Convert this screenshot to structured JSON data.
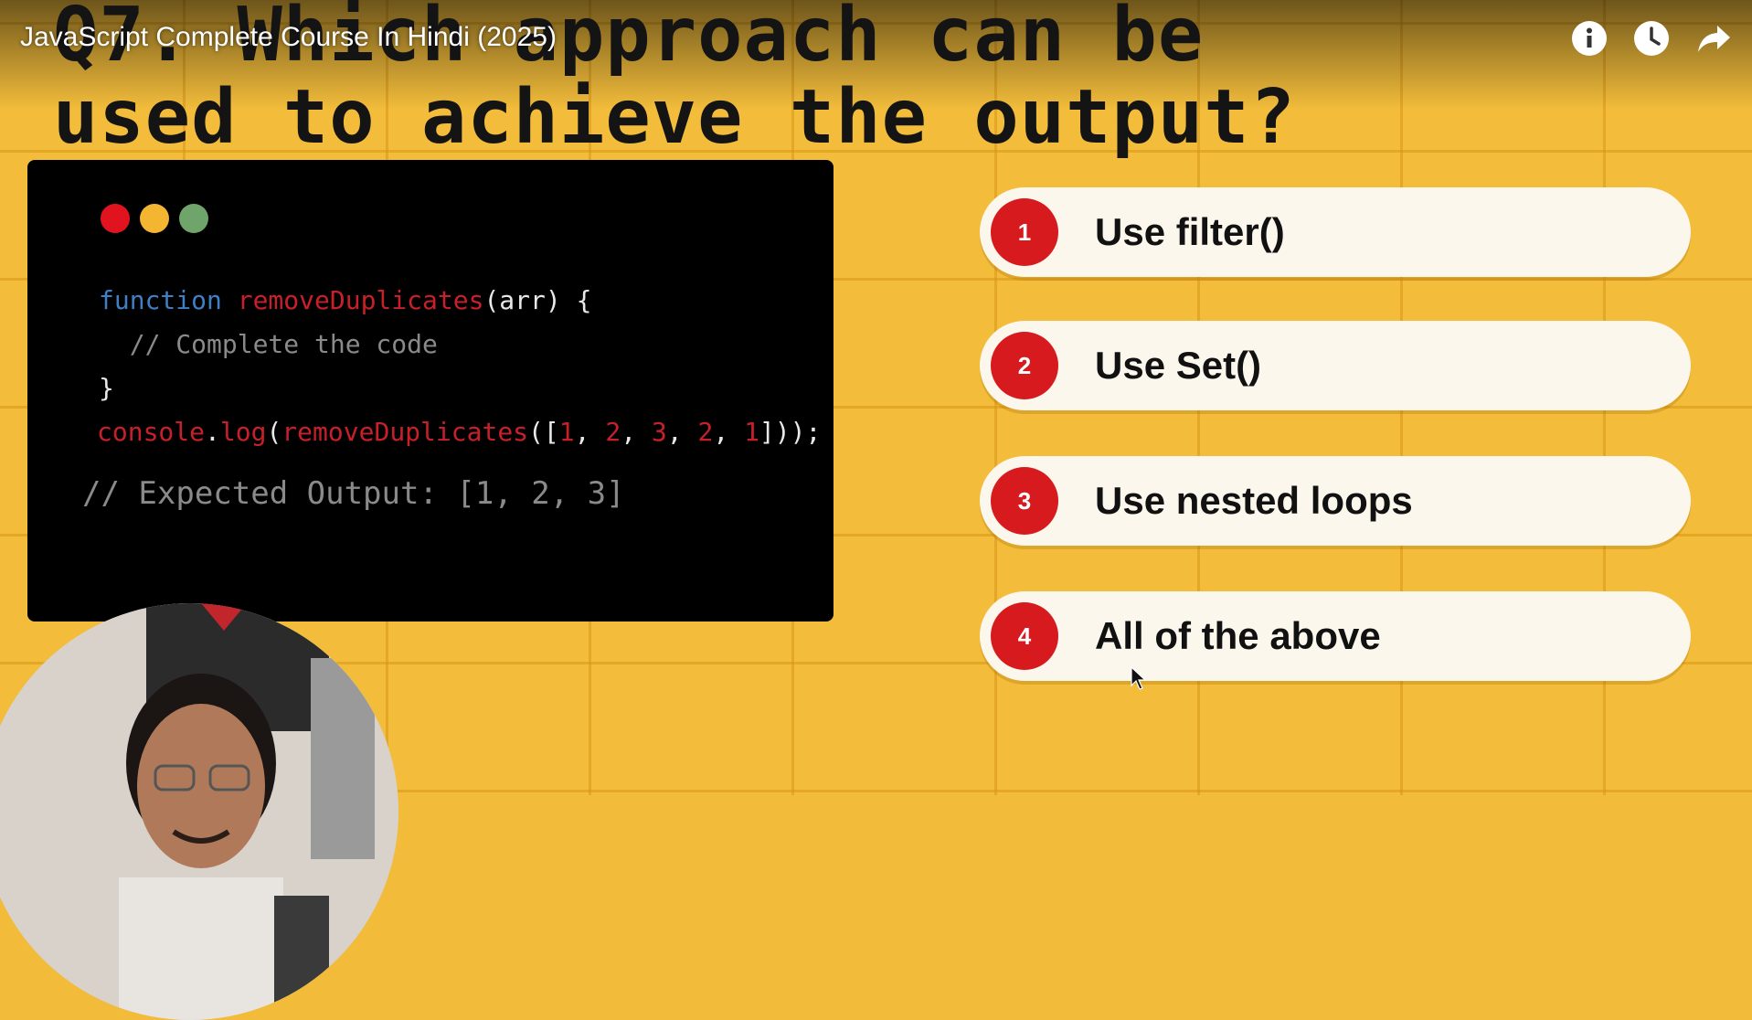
{
  "video": {
    "title": "JavaScript Complete Course In Hindi (2025)"
  },
  "top_icons": [
    "info-icon",
    "watch-later-icon",
    "share-icon"
  ],
  "slide": {
    "question_line1": "Q7. Which approach can be",
    "question_line2": "used to achieve the output?",
    "code": {
      "line1_kw": "function",
      "line1_fn": "removeDuplicates",
      "line1_rest": "(arr) {",
      "line2": "  // Complete the code",
      "line3": "}",
      "line4_obj": "console",
      "line4_dot": ".",
      "line4_method": "log",
      "line4_p1": "(",
      "line4_fn": "removeDuplicates",
      "line4_p2": "([",
      "line4_n1": "1",
      "line4_sep1": ", ",
      "line4_n2": "2",
      "line4_sep2": ", ",
      "line4_n3": "3",
      "line4_sep3": ", ",
      "line4_n4": "2",
      "line4_sep4": ", ",
      "line4_n5": "1",
      "line4_end": "]));",
      "expected": "// Expected Output: [1, 2, 3]"
    },
    "options": [
      {
        "num": "1",
        "text": "Use filter()"
      },
      {
        "num": "2",
        "text": "Use Set()"
      },
      {
        "num": "3",
        "text": "Use nested loops"
      },
      {
        "num": "4",
        "text": "All of the above"
      }
    ]
  },
  "colors": {
    "background": "#f2bb3a",
    "accent_red": "#d61a1e",
    "keyword_blue": "#3f7fc4",
    "dot_red": "#e0131f",
    "dot_yellow": "#f4b531",
    "dot_green": "#6fa56a"
  }
}
